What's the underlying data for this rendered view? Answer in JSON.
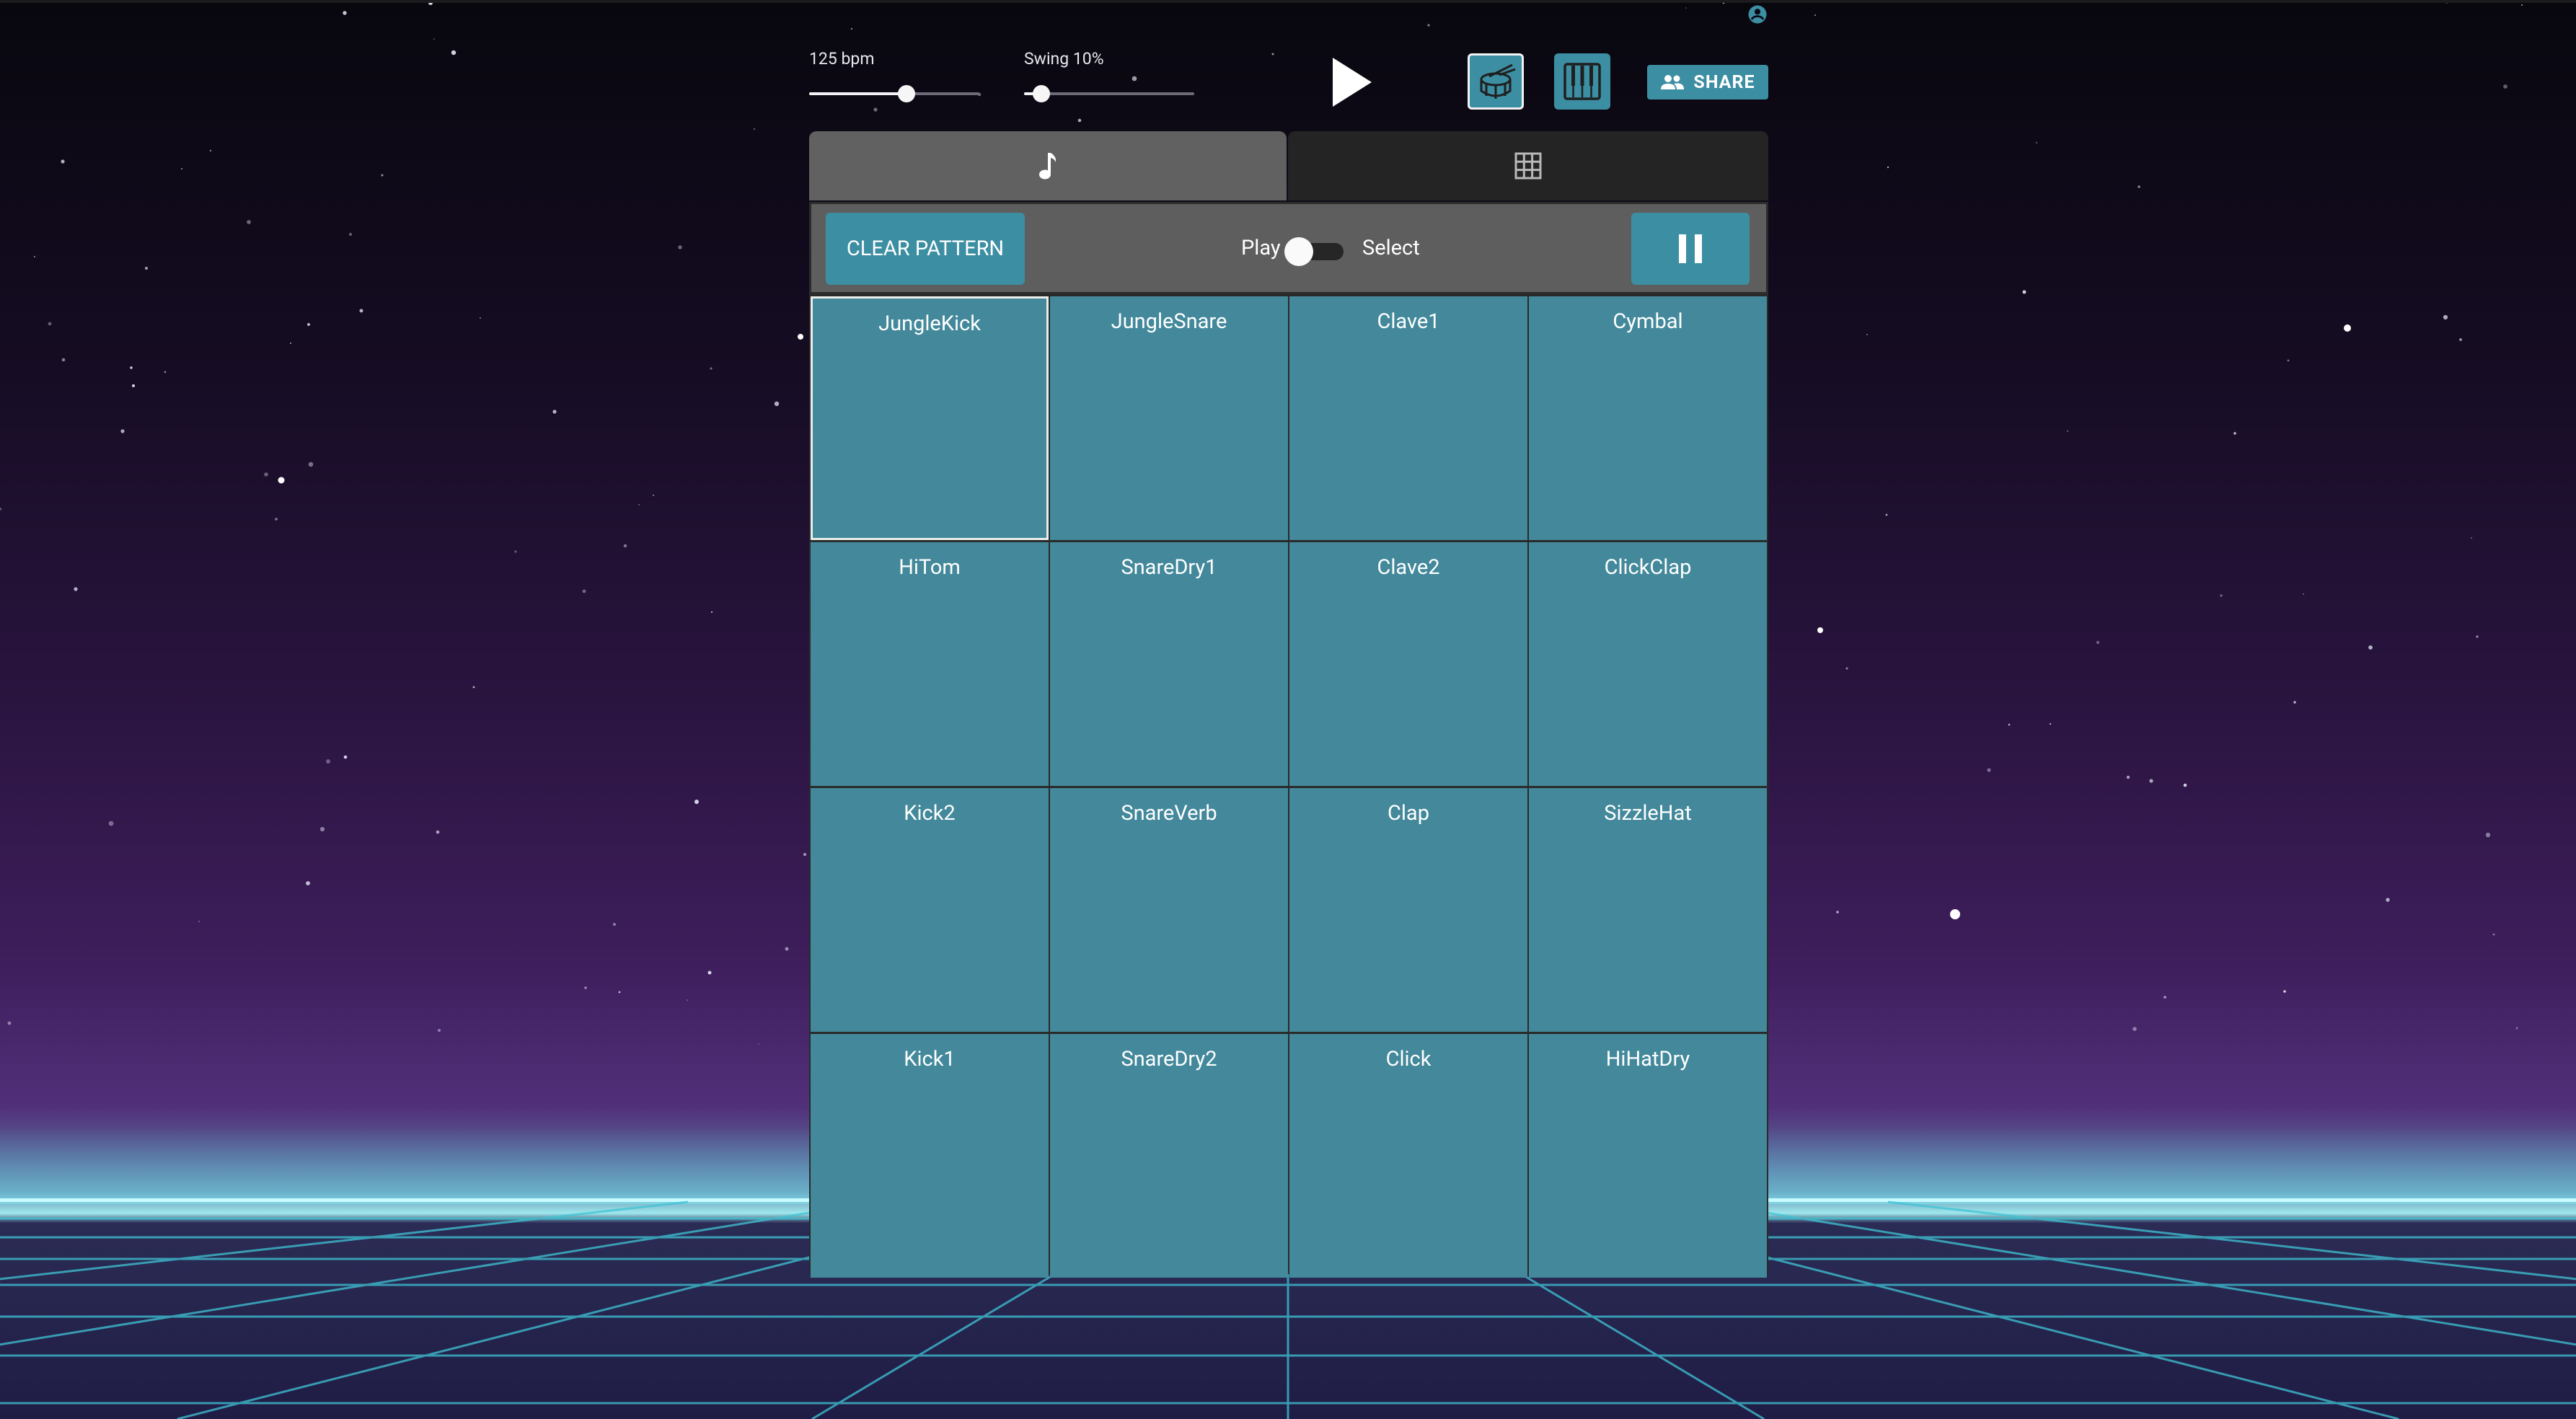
{
  "colors": {
    "accent": "#3c8ea3",
    "pad": "#43899b",
    "panel_tab_active": "#616161",
    "panel_tab_inactive": "#242424",
    "grid_line": "#3fd3e0"
  },
  "account": {
    "icon": "account-circle-icon"
  },
  "tempo": {
    "label": "125 bpm",
    "value_fraction": 0.57
  },
  "swing": {
    "label": "Swing 10%",
    "value_fraction": 0.1
  },
  "transport": {
    "play_icon": "play-icon"
  },
  "instruments": [
    {
      "icon": "drum-icon",
      "selected": true
    },
    {
      "icon": "piano-keys-icon",
      "selected": false
    }
  ],
  "share": {
    "label": "SHARE",
    "icon": "people-icon"
  },
  "tabs": [
    {
      "icon": "music-note-icon",
      "active": true
    },
    {
      "icon": "grid-icon",
      "active": false
    }
  ],
  "controls": {
    "clear_label": "CLEAR PATTERN",
    "mode_left": "Play",
    "mode_right": "Select",
    "pause_icon": "pause-icon"
  },
  "pads": [
    "JungleKick",
    "JungleSnare",
    "Clave1",
    "Cymbal",
    "HiTom",
    "SnareDry1",
    "Clave2",
    "ClickClap",
    "Kick2",
    "SnareVerb",
    "Clap",
    "SizzleHat",
    "Kick1",
    "SnareDry2",
    "Click",
    "HiHatDry"
  ],
  "selected_pad": 0
}
